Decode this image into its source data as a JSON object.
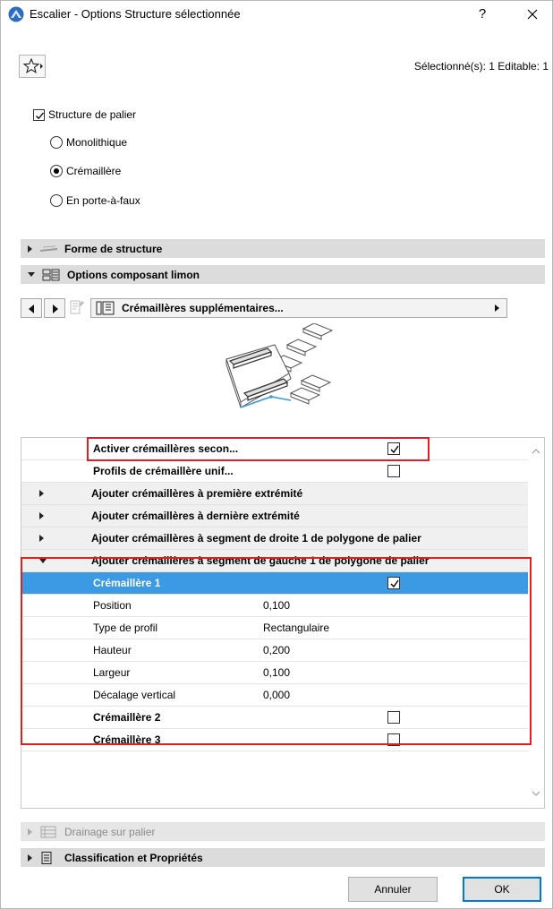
{
  "window": {
    "title": "Escalier - Options Structure sélectionnée",
    "help_label": "?"
  },
  "toolbar": {
    "selection_info": "Sélectionné(s): 1 Editable: 1"
  },
  "options": {
    "structure_checkbox": {
      "label": "Structure de palier",
      "checked": true
    },
    "radios": [
      {
        "label": "Monolithique",
        "selected": false
      },
      {
        "label": "Crémaillère",
        "selected": true
      },
      {
        "label": "En porte-à-faux",
        "selected": false
      }
    ]
  },
  "panels": {
    "forme": "Forme de structure",
    "options_limon": "Options composant limon",
    "drainage": "Drainage sur palier",
    "classification": "Classification et Propriétés"
  },
  "page_selector": {
    "current": "Crémaillères supplémentaires..."
  },
  "grid": {
    "rows": [
      {
        "name": "Activer crémaillères secon...",
        "checked": true,
        "type": "check"
      },
      {
        "name": "Profils de crémaillère unif...",
        "checked": false,
        "type": "check"
      },
      {
        "name": "Ajouter crémaillères à première extrémité",
        "type": "group",
        "expanded": false
      },
      {
        "name": "Ajouter crémaillères à dernière extrémité",
        "type": "group",
        "expanded": false
      },
      {
        "name": "Ajouter crémaillères à segment de droite 1 de polygone de palier",
        "type": "group",
        "expanded": false
      },
      {
        "name": "Ajouter crémaillères à segment de gauche 1 de polygone de palier",
        "type": "group",
        "expanded": true
      },
      {
        "name": "Crémaillère 1",
        "checked": true,
        "type": "check",
        "selected": true
      },
      {
        "name": "Position",
        "value": "0,100",
        "type": "value"
      },
      {
        "name": "Type de profil",
        "value": "Rectangulaire",
        "type": "value"
      },
      {
        "name": "Hauteur",
        "value": "0,200",
        "type": "value"
      },
      {
        "name": "Largeur",
        "value": "0,100",
        "type": "value"
      },
      {
        "name": "Décalage vertical",
        "value": "0,000",
        "type": "value"
      },
      {
        "name": "Crémaillère 2",
        "checked": false,
        "type": "check"
      },
      {
        "name": "Crémaillère 3",
        "checked": false,
        "type": "check"
      }
    ]
  },
  "buttons": {
    "cancel": "Annuler",
    "ok": "OK"
  },
  "colors": {
    "selection": "#3c99e4",
    "highlight": "#e02020",
    "panel": "#dcdcdc",
    "ok_border": "#0078d7"
  }
}
